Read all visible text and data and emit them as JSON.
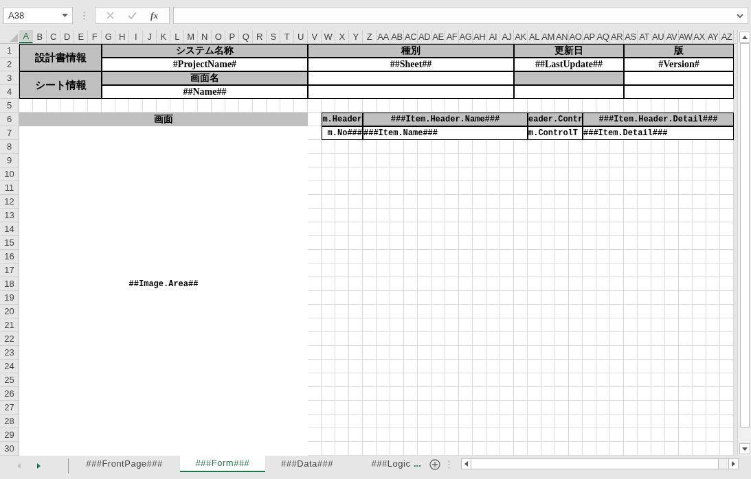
{
  "name_box": {
    "value": "A38"
  },
  "formula_bar": {
    "function_label": "fx"
  },
  "column_headers": [
    {
      "label": "A",
      "selected": true
    },
    {
      "label": "B",
      "selected": false
    },
    {
      "label": "C",
      "selected": false
    },
    {
      "label": "D",
      "selected": false
    },
    {
      "label": "E",
      "selected": false
    },
    {
      "label": "F",
      "selected": false
    },
    {
      "label": "G",
      "selected": false
    },
    {
      "label": "H",
      "selected": false
    },
    {
      "label": "I",
      "selected": false
    },
    {
      "label": "J",
      "selected": false
    },
    {
      "label": "K",
      "selected": false
    },
    {
      "label": "L",
      "selected": false
    },
    {
      "label": "M",
      "selected": false
    },
    {
      "label": "N",
      "selected": false
    },
    {
      "label": "O",
      "selected": false
    },
    {
      "label": "P",
      "selected": false
    },
    {
      "label": "Q",
      "selected": false
    },
    {
      "label": "R",
      "selected": false
    },
    {
      "label": "S",
      "selected": false
    },
    {
      "label": "T",
      "selected": false
    },
    {
      "label": "U",
      "selected": false
    },
    {
      "label": "V",
      "selected": false
    },
    {
      "label": "W",
      "selected": false
    },
    {
      "label": "X",
      "selected": false
    },
    {
      "label": "Y",
      "selected": false
    },
    {
      "label": "Z",
      "selected": false
    },
    {
      "label": "AA",
      "selected": false
    },
    {
      "label": "AB",
      "selected": false
    },
    {
      "label": "AC",
      "selected": false
    },
    {
      "label": "AD",
      "selected": false
    },
    {
      "label": "AE",
      "selected": false
    },
    {
      "label": "AF",
      "selected": false
    },
    {
      "label": "AG",
      "selected": false
    },
    {
      "label": "AH",
      "selected": false
    },
    {
      "label": "AI",
      "selected": false
    },
    {
      "label": "AJ",
      "selected": false
    },
    {
      "label": "AK",
      "selected": false
    },
    {
      "label": "AL",
      "selected": false
    },
    {
      "label": "AM",
      "selected": false
    },
    {
      "label": "AN",
      "selected": false
    },
    {
      "label": "AO",
      "selected": false
    },
    {
      "label": "AP",
      "selected": false
    },
    {
      "label": "AQ",
      "selected": false
    },
    {
      "label": "AR",
      "selected": false
    },
    {
      "label": "AS",
      "selected": false
    },
    {
      "label": "AT",
      "selected": false
    },
    {
      "label": "AU",
      "selected": false
    },
    {
      "label": "AV",
      "selected": false
    },
    {
      "label": "AW",
      "selected": false
    },
    {
      "label": "AX",
      "selected": false
    },
    {
      "label": "AY",
      "selected": false
    },
    {
      "label": "AZ",
      "selected": false
    }
  ],
  "row_headers": [
    "1",
    "2",
    "3",
    "4",
    "5",
    "6",
    "7",
    "8",
    "9",
    "10",
    "11",
    "12",
    "13",
    "14",
    "15",
    "16",
    "17",
    "18",
    "19",
    "20",
    "21",
    "22",
    "23",
    "24",
    "25",
    "26",
    "27",
    "28",
    "29",
    "30"
  ],
  "cells": [
    {
      "text": "設計書情報",
      "kind": "label"
    },
    {
      "text": "システム名称",
      "kind": "header"
    },
    {
      "text": "種別",
      "kind": "header"
    },
    {
      "text": "更新日",
      "kind": "header"
    },
    {
      "text": "版",
      "kind": "header"
    },
    {
      "text": "#ProjectName#",
      "kind": "value"
    },
    {
      "text": "##Sheet##",
      "kind": "value"
    },
    {
      "text": "##LastUpdate##",
      "kind": "value"
    },
    {
      "text": "#Version#",
      "kind": "value"
    },
    {
      "text": "シート情報",
      "kind": "label"
    },
    {
      "text": "画面名",
      "kind": "header"
    },
    {
      "kind": "value"
    },
    {
      "kind": "header"
    },
    {
      "kind": "value"
    },
    {
      "text": "##Name##",
      "kind": "value"
    },
    {
      "kind": "value"
    },
    {
      "kind": "value"
    },
    {
      "kind": "value"
    },
    {
      "text": "画面",
      "kind": "screen_header"
    },
    {
      "text": "##Image.Area##",
      "kind": "image_area"
    },
    {
      "text": "m.Header",
      "kind": "item_header"
    },
    {
      "text": "###Item.Header.Name###",
      "kind": "item_header"
    },
    {
      "text": "eader.Contr",
      "kind": "item_header"
    },
    {
      "text": "###Item.Header.Detail###",
      "kind": "item_header"
    },
    {
      "text": "m.No###",
      "kind": "item_value"
    },
    {
      "text": "###Item.Name###",
      "kind": "item_value"
    },
    {
      "text": "m.ControlT",
      "kind": "item_value"
    },
    {
      "text": "###Item.Detail###",
      "kind": "item_value"
    }
  ],
  "sheet_tabs": [
    {
      "label": "###FrontPage###",
      "selected": false
    },
    {
      "label": "###Form###",
      "selected": true
    },
    {
      "label": "###Data###",
      "selected": false
    },
    {
      "label": "###Logic",
      "selected": false
    }
  ],
  "more_tabs": "..."
}
